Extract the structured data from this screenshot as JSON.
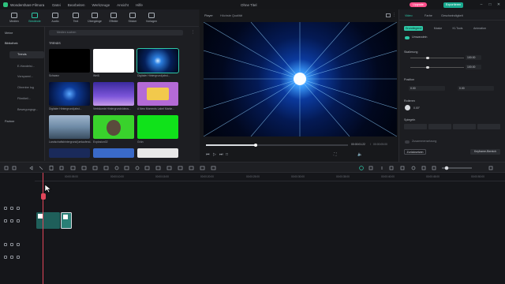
{
  "app": {
    "name": "Wondershare Filmora",
    "document": "Ohne Titel",
    "upgrade": "Upgrade",
    "export": "Exportieren"
  },
  "menu": [
    "Datei",
    "Bearbeiten",
    "Werkzeuge",
    "Ansicht",
    "Hilfe"
  ],
  "toolbar": [
    "Medien",
    "Bestände",
    "Audio",
    "Text",
    "Übergänge",
    "Effekte",
    "Sticker",
    "Vorlagen"
  ],
  "left_nav": {
    "mine": "Meine",
    "library": "Bibliothek",
    "trends": "Trends",
    "items": [
      "E-Handelsi...",
      "Vorspann/...",
      "Ohrenbe log",
      "Filmtitel/...",
      "Bewegungsgr..."
    ],
    "partner": "Partner"
  },
  "search": {
    "placeholder": "Medien suchen"
  },
  "library": {
    "section": "TRENDS",
    "items": [
      {
        "label": "Schwarz"
      },
      {
        "label": "Weiß"
      },
      {
        "label": "Digitaler Hintergrund(abst..."
      },
      {
        "label": "Digitaler Hintergrund(abst..."
      },
      {
        "label": "Verträumte Hintergrundvideos..."
      },
      {
        "label": "A New Moments Label Marke..."
      },
      {
        "label": "Landschaftshintergrund(umlaufend...)"
      },
      {
        "label": "Explosion02"
      },
      {
        "label": "Grün"
      }
    ]
  },
  "player": {
    "tab": "Player",
    "quality": "Höchste Qualität",
    "time_current": "00:00:01:22",
    "time_total": "00:00:05:00"
  },
  "props": {
    "tabs": [
      "Video",
      "Farbe",
      "Geschwindigkeit"
    ],
    "subtabs": [
      "Grundlegend",
      "Maske",
      "KI-Tools",
      "Animation"
    ],
    "transform": "Umwandeln",
    "scale": "Skalierung",
    "scale_x": "100.00",
    "scale_y": "100.00",
    "position": "Position",
    "pos_x": "0.00",
    "pos_y": "0.00",
    "rotate": "Rotieren",
    "rotate_val": "0.00°",
    "mirror": "Spiegeln",
    "compositing": "Zusammensetzung",
    "reset": "Zurücksetzen",
    "keyframe": "Keyframe-Bereich"
  },
  "timeline": {
    "ticks": [
      "00:00:05:00",
      "00:00:10:00",
      "00:00:15:00",
      "00:00:20:00",
      "00:00:25:00",
      "00:00:30:00",
      "00:00:35:00",
      "00:00:40:00",
      "00:00:45:00",
      "00:00:50:00"
    ]
  }
}
